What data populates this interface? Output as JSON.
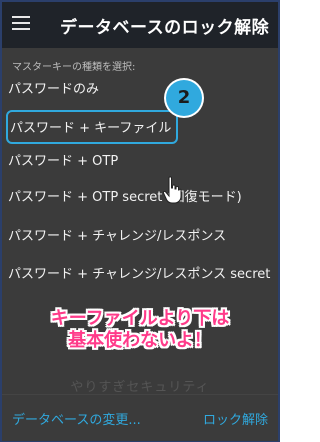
{
  "appbar": {
    "title": "データベースのロック解除",
    "menu_icon": "hamburger-icon"
  },
  "content": {
    "subtitle": "マスターキーの種類を選択:",
    "options": [
      {
        "label": "パスワードのみ"
      },
      {
        "label": "パスワード + キーファイル",
        "selected": true
      },
      {
        "label": "パスワード + OTP"
      },
      {
        "label": "パスワード + OTP secret (回復モード)"
      },
      {
        "label": "パスワード + チャレンジ/レスポンス"
      },
      {
        "label": "パスワード + チャレンジ/レスポンス secret (回"
      }
    ]
  },
  "overlay": {
    "step_badge": "2",
    "annotation_line1": "キーファイルより下は",
    "annotation_line2": "基本使わないよ！",
    "watermark": "やりすぎセキュリティ"
  },
  "bottombar": {
    "change_database": "データベースの変更...",
    "unlock": "ロック解除"
  },
  "colors": {
    "appbar_bg": "#1f2329",
    "content_bg": "#3b3b3b",
    "accent": "#30a9de",
    "annotation": "#ff3b8a"
  }
}
